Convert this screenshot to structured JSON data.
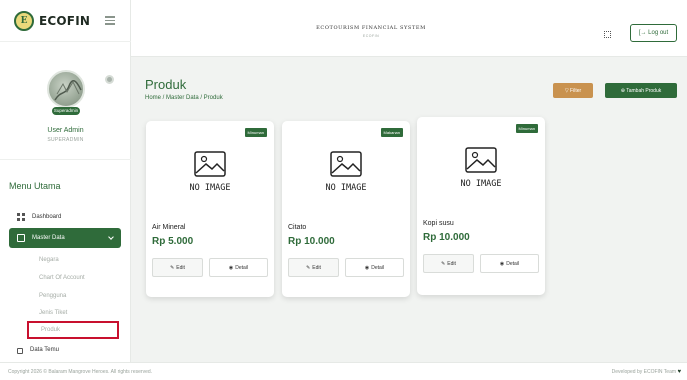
{
  "app": {
    "logo_text": "ECOFIN",
    "header_title": "ECOTOURISM FINANCIAL SYSTEM",
    "header_subtitle": "ECOFIN",
    "logout_label": "[→ Log out"
  },
  "user": {
    "name": "User Admin",
    "role": "SUPERADMIN",
    "badge": "Superadmin"
  },
  "sidebar": {
    "menu_title": "Menu Utama",
    "items": [
      {
        "label": "Dashboard"
      },
      {
        "label": "Master Data"
      },
      {
        "label": "Data Temu"
      }
    ],
    "submenu": [
      "Negara",
      "Chart Of Account",
      "Pengguna",
      "Jenis Tiket",
      "Produk"
    ]
  },
  "page": {
    "title": "Produk",
    "breadcrumb": "Home / Master Data / Produk",
    "filter_label": "▽ Filter",
    "add_label": "⊕ Tambah Produk"
  },
  "products": [
    {
      "category": "Minuman",
      "placeholder": "NO IMAGE",
      "name": "Air Mineral",
      "price": "Rp 5.000",
      "edit": "Edit",
      "detail": "Detail"
    },
    {
      "category": "Makanan",
      "placeholder": "NO IMAGE",
      "name": "Citato",
      "price": "Rp 10.000",
      "edit": "Edit",
      "detail": "Detail"
    },
    {
      "category": "Minuman",
      "placeholder": "NO IMAGE",
      "name": "Kopi susu",
      "price": "Rp 10.000",
      "edit": "Edit",
      "detail": "Detail"
    }
  ],
  "footer": {
    "copyright": "Copyright 2026 © Balaram Mangrove Heroes. All rights reserved.",
    "developed": "Developed by ECOFIN Team"
  },
  "colors": {
    "primary": "#2f6b3a",
    "filter": "#c9924f",
    "highlight_border": "#c8102e"
  }
}
